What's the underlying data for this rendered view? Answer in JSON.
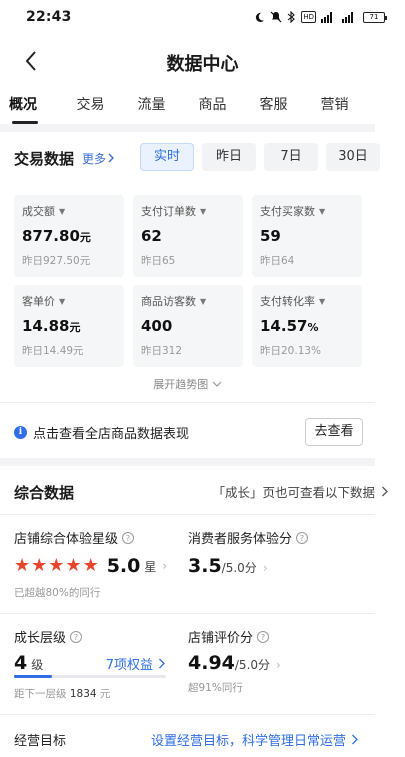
{
  "status_bar": {
    "time": "22:43",
    "icons": [
      "moon-icon",
      "mute-icon",
      "bluetooth-icon",
      "hd-icon",
      "signal-icon",
      "signal-icon",
      "battery-icon"
    ],
    "hd_label": "HD",
    "battery_level": "71"
  },
  "header": {
    "title": "数据中心"
  },
  "tabs": [
    {
      "label": "概况",
      "active": true
    },
    {
      "label": "交易",
      "active": false
    },
    {
      "label": "流量",
      "active": false
    },
    {
      "label": "商品",
      "active": false
    },
    {
      "label": "客服",
      "active": false
    },
    {
      "label": "营销",
      "active": false
    }
  ],
  "trade_section": {
    "title": "交易数据",
    "more": "更多",
    "ranges": [
      {
        "label": "实时",
        "active": true
      },
      {
        "label": "昨日",
        "active": false
      },
      {
        "label": "7日",
        "active": false
      },
      {
        "label": "30日",
        "active": false
      }
    ],
    "metrics": [
      {
        "name": "成交额",
        "value": "877.80",
        "unit": "元",
        "prev": "昨日927.50元"
      },
      {
        "name": "支付订单数",
        "value": "62",
        "unit": "",
        "prev": "昨日65"
      },
      {
        "name": "支付买家数",
        "value": "59",
        "unit": "",
        "prev": "昨日64"
      },
      {
        "name": "客单价",
        "value": "14.88",
        "unit": "元",
        "prev": "昨日14.49元"
      },
      {
        "name": "商品访客数",
        "value": "400",
        "unit": "",
        "prev": "昨日312"
      },
      {
        "name": "支付转化率",
        "value": "14.57",
        "unit": "%",
        "prev": "昨日20.13%"
      }
    ],
    "expand_trend": "展开趋势图"
  },
  "notice": {
    "text": "点击查看全店商品数据表现",
    "button": "去查看"
  },
  "comprehensive": {
    "title": "综合数据",
    "hint": "「成长」页也可查看以下数据",
    "store_rating": {
      "label": "店铺综合体验星级",
      "stars": 5,
      "value": "5.0",
      "unit": "星",
      "sub": "已超越80%的同行"
    },
    "consumer_score": {
      "label": "消费者服务体验分",
      "value": "3.5",
      "unit": "/5.0分"
    },
    "growth_level": {
      "label": "成长层级",
      "value": "4",
      "unit": "级",
      "rights": "7项权益",
      "progress": 0.25,
      "sub_prefix": "距下一层级",
      "sub_value": "1834",
      "sub_unit": "元"
    },
    "store_review": {
      "label": "店铺评价分",
      "value": "4.94",
      "unit": "/5.0分",
      "sub": "超91%同行"
    }
  },
  "goal": {
    "label": "经营目标",
    "link": "设置经营目标，科学管理日常运营"
  },
  "colors": {
    "accent": "#2f6ee8",
    "star": "#e8452c",
    "divider": "#f3f3f5"
  }
}
